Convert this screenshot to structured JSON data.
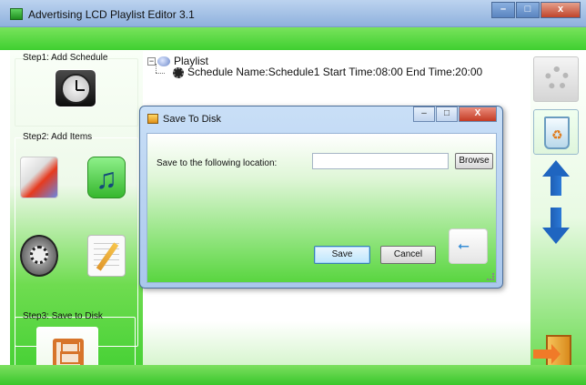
{
  "window": {
    "title": "Advertising LCD Playlist Editor 3.1",
    "buttons": {
      "minimize": "–",
      "maximize": "□",
      "close": "x"
    }
  },
  "left_panel": {
    "step1_label": "Step1: Add Schedule",
    "step2_label": "Step2: Add Items",
    "step3_label": "Step3: Save to Disk"
  },
  "playlist": {
    "root": "Playlist",
    "schedule": "Schedule Name:Schedule1  Start Time:08:00  End Time:20:00"
  },
  "dialog": {
    "title": "Save To Disk",
    "buttons": {
      "minimize": "–",
      "maximize": "□",
      "close": "X"
    },
    "location_label": "Save  to the following location:",
    "location_value": "",
    "browse_label": "Browse",
    "save_label": "Save",
    "cancel_label": "Cancel"
  },
  "icons": {
    "clock": "clock-icon",
    "picture": "picture-icon",
    "music": "music-icon",
    "video": "film-reel-icon",
    "text": "notepad-icon",
    "disk": "floppy-disk-icon",
    "settings": "gear-icon",
    "delete": "recycle-bin-icon",
    "move_up": "arrow-up-icon",
    "move_down": "arrow-down-icon",
    "exit": "exit-door-icon",
    "usb": "usb-icon"
  },
  "colors": {
    "accent_green": "#3fcf30",
    "title_blue": "#8fb1dd",
    "arrow_blue": "#1f65c0",
    "disk_orange": "#d7742a"
  }
}
